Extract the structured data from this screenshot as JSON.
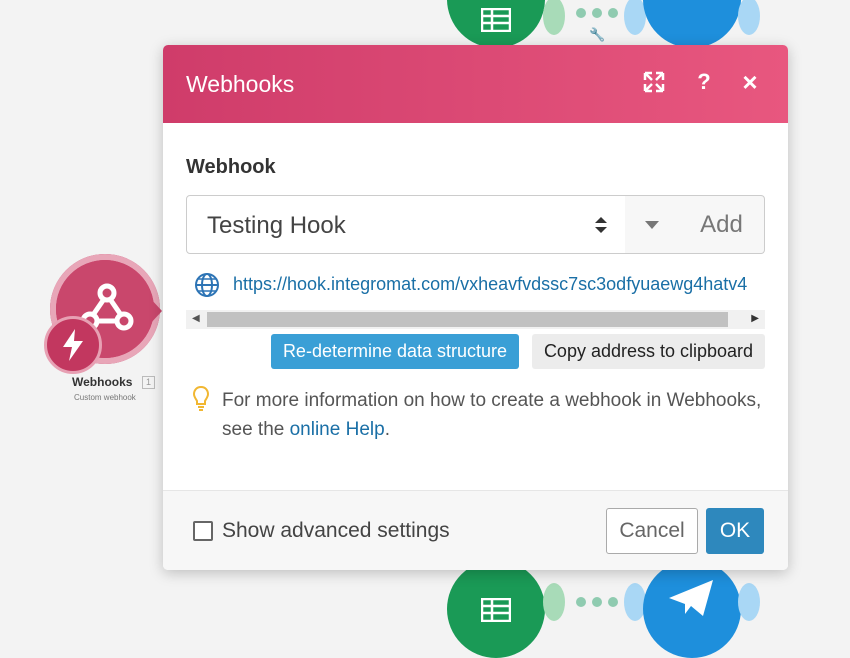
{
  "canvas": {
    "module": {
      "name": "Webhooks",
      "badge": "1",
      "subtitle": "Custom webhook"
    }
  },
  "dialog": {
    "title": "Webhooks",
    "header_icons": [
      "expand-icon",
      "help-icon",
      "close-icon"
    ],
    "header_help_glyph": "?",
    "header_close_glyph": "×",
    "field_label": "Webhook",
    "select_value": "Testing Hook",
    "add_label": "Add",
    "url": "https://hook.integromat.com/vxheavfvdssc7sc3odfyuaewg4hatv4",
    "redetermine_label": "Re-determine data structure",
    "copy_label": "Copy address to clipboard",
    "info_text": "For more information on how to create a webhook in Webhooks, see the",
    "info_link": "online Help",
    "info_end": ".",
    "advanced_label": "Show advanced settings",
    "cancel_label": "Cancel",
    "ok_label": "OK"
  },
  "colors": {
    "header_start": "#cf3c6a",
    "header_end": "#e8577f",
    "primary_blue": "#3a9fd6",
    "ok_blue": "#2e88bd",
    "link": "#1a6fa6"
  }
}
